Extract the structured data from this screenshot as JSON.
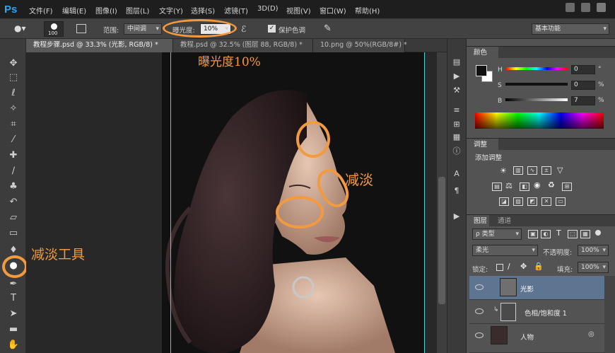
{
  "app": {
    "logo": "Ps"
  },
  "menubar": {
    "items": [
      "文件(F)",
      "编辑(E)",
      "图像(I)",
      "图层(L)",
      "文字(Y)",
      "选择(S)",
      "滤镜(T)",
      "3D(D)",
      "视图(V)",
      "窗口(W)",
      "帮助(H)"
    ]
  },
  "options": {
    "brush_size": "100",
    "range_label": "范围:",
    "range_value": "中间调",
    "exposure_label": "曝光度:",
    "exposure_value": "10%",
    "protect_label": "保护色调",
    "protect_checked": true,
    "workspace": "基本功能"
  },
  "tabs": [
    {
      "label": "教程步骤.psd @ 33.3% (光影, RGB/8) *",
      "active": true
    },
    {
      "label": "教程.psd @ 32.5% (图层 88, RGB/8) *",
      "active": false
    },
    {
      "label": "10.png @ 50%(RGB/8#) *",
      "active": false
    }
  ],
  "color_panel": {
    "title": "颜色",
    "channels": [
      {
        "label": "H",
        "value": "0",
        "unit": "°"
      },
      {
        "label": "S",
        "value": "0",
        "unit": "%"
      },
      {
        "label": "B",
        "value": "7",
        "unit": "%"
      }
    ]
  },
  "adjust_panel": {
    "title": "调整",
    "subtitle": "添加调整"
  },
  "layers_panel": {
    "tabs": [
      "图层",
      "通道"
    ],
    "filter": "ρ 类型",
    "blend_mode": "柔光",
    "opacity_label": "不透明度:",
    "opacity_value": "100%",
    "lock_label": "锁定:",
    "fill_label": "填充:",
    "fill_value": "100%",
    "layers": [
      {
        "name": "光影",
        "selected": true
      },
      {
        "name": "色相/饱和度 1",
        "selected": false
      },
      {
        "name": "人物",
        "selected": false
      }
    ]
  },
  "annotations": {
    "exposure_note": "曝光度10%",
    "dodge_note": "减淡",
    "tool_note": "减淡工具"
  },
  "colors": {
    "annotation": "#f29a3f",
    "guide": "#3fd6d6",
    "selected_layer": "#5e7591"
  }
}
